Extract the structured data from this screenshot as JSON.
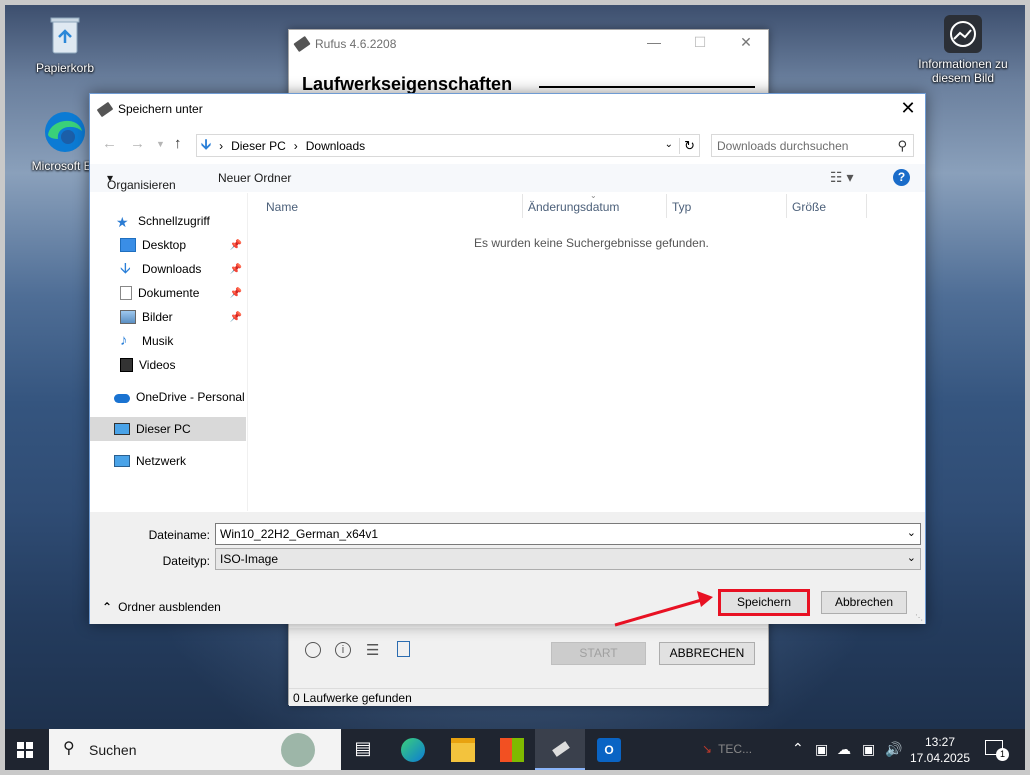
{
  "desktop": {
    "icons": [
      {
        "label": "Papierkorb"
      },
      {
        "label": "Microsoft Ed"
      },
      {
        "label": "Informationen zu diesem Bild"
      }
    ]
  },
  "rufus": {
    "title": "Rufus 4.6.2208",
    "heading": "Laufwerkseigenschaften",
    "start_label": "START",
    "cancel_label": "ABBRECHEN",
    "status": "0 Laufwerke gefunden"
  },
  "dialog": {
    "title": "Speichern unter",
    "breadcrumb": [
      "Dieser PC",
      "Downloads"
    ],
    "search_placeholder": "Downloads durchsuchen",
    "organize_label": "Organisieren",
    "new_folder_label": "Neuer Ordner",
    "nav": {
      "quick_access": "Schnellzugriff",
      "items": [
        "Desktop",
        "Downloads",
        "Dokumente",
        "Bilder",
        "Musik",
        "Videos"
      ],
      "onedrive": "OneDrive - Personal",
      "this_pc": "Dieser PC",
      "network": "Netzwerk"
    },
    "columns": [
      "Name",
      "Änderungsdatum",
      "Typ",
      "Größe"
    ],
    "empty_message": "Es wurden keine Suchergebnisse gefunden.",
    "filename_label": "Dateiname:",
    "filename_value": "Win10_22H2_German_x64v1",
    "filetype_label": "Dateityp:",
    "filetype_value": "ISO-Image",
    "hide_folders_label": "Ordner ausblenden",
    "save_label": "Speichern",
    "cancel_label": "Abbrechen"
  },
  "taskbar": {
    "search_label": "Suchen",
    "tray_partial": "TEC...",
    "time": "13:27",
    "date": "17.04.2025",
    "notification_count": "1"
  },
  "colors": {
    "highlight": "#e81123",
    "accent": "#0078d4"
  }
}
